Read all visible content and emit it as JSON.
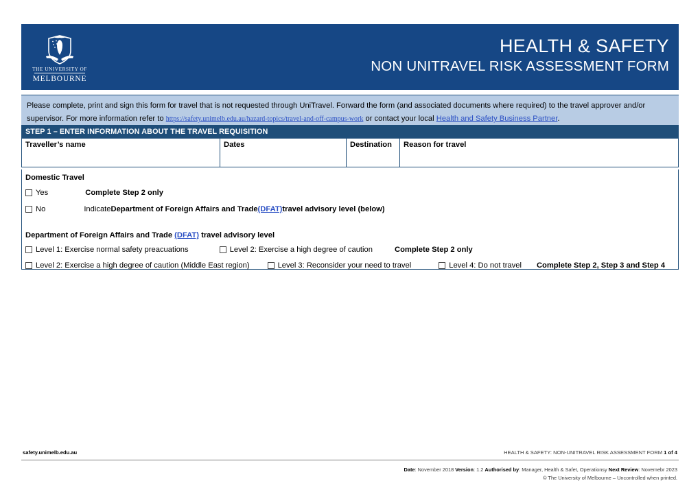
{
  "header": {
    "title_main": "HEALTH & SAFETY",
    "title_sub": "NON UNITRAVEL RISK ASSESSMENT FORM",
    "logo_line1": "THE UNIVERSITY OF",
    "logo_line2": "MELBOURNE",
    "brand_blue": "#164785"
  },
  "intro": {
    "text_part1": "Please complete, print and sign this form for travel that is not requested through UniTravel.  Forward the form (and associated documents where required) to the travel approver and/or supervisor.  For more information refer to ",
    "url_text": "https://safety.unimelb.edu.au/hazard-topics/travel-and-off-campus-work",
    "text_part2": " or contact your local ",
    "link_text": "Health and Safety Business Partner",
    "text_part3": ".",
    "background": "#b8cce4"
  },
  "step_bar": {
    "label": "STEP 1 – ENTER INFORMATION ABOUT THE TRAVEL REQUISITION",
    "background": "#1f4e79"
  },
  "info_table": {
    "columns": [
      {
        "label": "Traveller’s name",
        "value": ""
      },
      {
        "label": "Dates",
        "value": ""
      },
      {
        "label": "Destination",
        "value": ""
      },
      {
        "label": "Reason for travel",
        "value": ""
      }
    ]
  },
  "domestic": {
    "heading": "Domestic Travel",
    "yes": {
      "checkbox_label": "Yes",
      "checked": false,
      "instruction": "Complete Step 2 only"
    },
    "no": {
      "checkbox_label": "No",
      "checked": false,
      "instruction_pre": "Indicate ",
      "instruction_bold1": "Department of Foreign Affairs and Trade ",
      "instruction_link": "(DFAT)",
      "instruction_bold2": " travel advisory level (below)"
    }
  },
  "dfat": {
    "heading_pre": "Department of Foreign Affairs and Trade ",
    "heading_link": "(DFAT)",
    "heading_post": " travel advisory level",
    "row1": {
      "level1_label": "Level 1:  Exercise normal safety preacuations",
      "level1_checked": false,
      "level2_label": "Level 2:  Exercise a high degree of caution",
      "level2_checked": false,
      "instruction": "Complete Step 2 only"
    },
    "row2": {
      "level2me_label": "Level 2:  Exercise a high degree of caution (Middle East region)",
      "level2me_checked": false,
      "level3_label": "Level 3:  Reconsider your need to travel",
      "level3_checked": false,
      "level4_label": "Level 4:  Do not travel",
      "level4_checked": false,
      "instruction": "Complete Step 2, Step 3 and Step 4"
    }
  },
  "footer": {
    "left": "safety.unimelb.edu.au",
    "right_doc": "HEALTH & SAFETY:  NON-UNITRAVEL RISK ASSESSMENT FORM ",
    "right_page": "1",
    "right_of": " of 4",
    "meta_line1_date_label": "Date",
    "meta_line1_date_value": ": November 2018 ",
    "meta_line1_version_label": "Version",
    "meta_line1_version_value": ": 1.2 ",
    "meta_line1_auth_label": "Authorised by",
    "meta_line1_auth_value": ": Manager, Health & Safet, Operationsy ",
    "meta_line1_review_label": "Next Review",
    "meta_line1_review_value": ": Novemebr 2023",
    "meta_line2": "© The University of Melbourne – Uncontrolled when printed."
  }
}
